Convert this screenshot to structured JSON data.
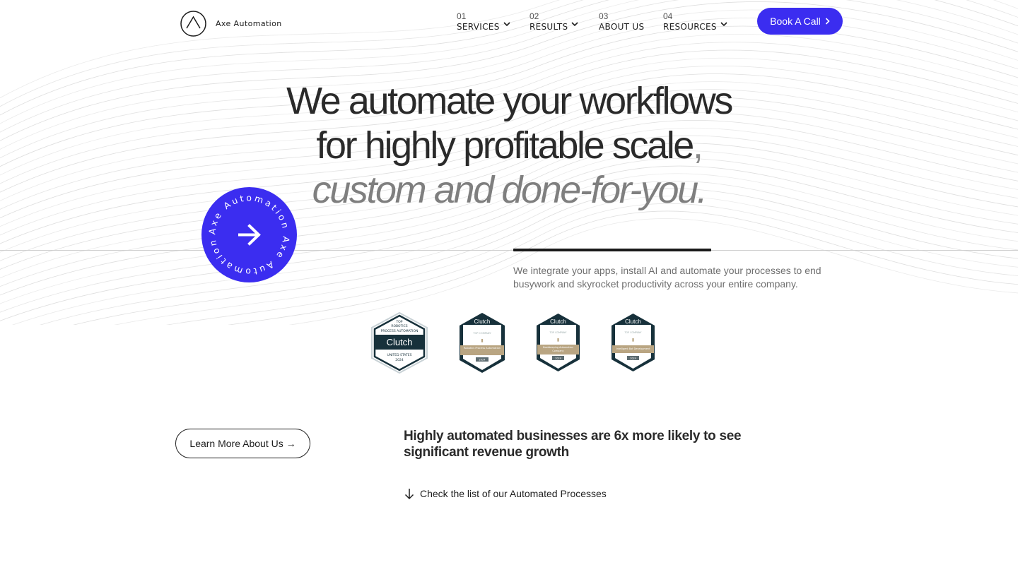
{
  "header": {
    "logo_text": "Axe Automation",
    "nav": [
      {
        "num": "01",
        "label": "SERVICES",
        "dropdown": true
      },
      {
        "num": "02",
        "label": "RESULTS",
        "dropdown": true
      },
      {
        "num": "03",
        "label": "ABOUT US",
        "dropdown": false
      },
      {
        "num": "04",
        "label": "RESOURCES",
        "dropdown": true
      }
    ],
    "cta_label": "Book A Call",
    "cta_icon": "chevron-right-icon"
  },
  "hero": {
    "line1": "We automate your workflows",
    "line2": "for highly profitable scale",
    "line2_comma": ",",
    "line3": "custom and done-for-you."
  },
  "rotating_badge": {
    "text": "Axe Automation Axe Automation ",
    "icon": "arrow-right-icon"
  },
  "intro": {
    "text": "We integrate your apps, install AI and automate your processes to end busywork and skyrocket productivity across your entire company."
  },
  "awards": [
    {
      "brand": "Clutch",
      "top": "TOP",
      "category": "ROBOTICS",
      "sub": "PROCESS AUTOMATION",
      "region": "UNITED STATES",
      "year": "2024"
    },
    {
      "brand": "Clutch",
      "top": "TOP COMPANY",
      "category": "Robotics Process Automation",
      "year": "2024"
    },
    {
      "brand": "Clutch",
      "top": "TOP COMPANY",
      "category": "Bookkeeping Automation Company",
      "year": "2024"
    },
    {
      "brand": "Clutch",
      "top": "TOP COMPANY",
      "category": "Intelligent Bot Development",
      "year": "2024"
    }
  ],
  "about": {
    "learn_more_label": "Learn More About Us →",
    "stat_heading": "Highly automated businesses are 6x more likely to see significant revenue growth",
    "check_list_label": "Check the list of our Automated Processes"
  },
  "colors": {
    "accent": "#3b2df0",
    "text": "#2a2a2a",
    "muted": "#7f7f7f",
    "clutch_dark": "#17313b",
    "clutch_gold": "#b9a582"
  }
}
